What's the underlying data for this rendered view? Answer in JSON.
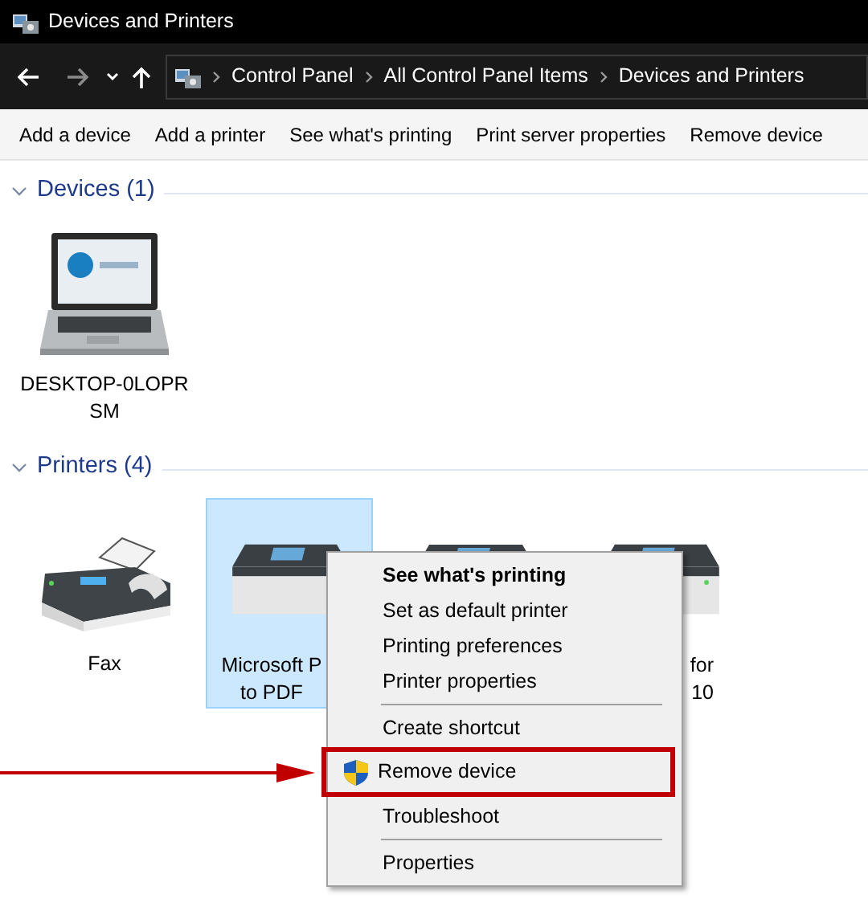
{
  "window": {
    "title": "Devices and Printers"
  },
  "address_bar": {
    "breadcrumbs": [
      "Control Panel",
      "All Control Panel Items",
      "Devices and Printers"
    ]
  },
  "command_bar": [
    "Add a device",
    "Add a printer",
    "See what's printing",
    "Print server properties",
    "Remove device"
  ],
  "sections": [
    {
      "title": "Devices (1)",
      "expanded": true,
      "items": [
        {
          "kind": "laptop",
          "label_lines": [
            "DESKTOP-0LOPR",
            "SM"
          ],
          "selected": false
        }
      ]
    },
    {
      "title": "Printers (4)",
      "expanded": true,
      "items": [
        {
          "kind": "fax",
          "label_lines": [
            "Fax"
          ],
          "selected": false
        },
        {
          "kind": "printer",
          "label_lines": [
            "Microsoft P",
            "to PDF"
          ],
          "selected": true
        },
        {
          "kind": "printer",
          "selected": false
        },
        {
          "kind": "printer",
          "label_lines": [
            "for",
            "10"
          ],
          "selected": false
        }
      ]
    }
  ],
  "context_menu": [
    {
      "kind": "item",
      "label": "See what's printing",
      "default": true,
      "highlighted": false
    },
    {
      "kind": "item",
      "label": "Set as default printer",
      "default": false,
      "highlighted": false
    },
    {
      "kind": "item",
      "label": "Printing preferences",
      "default": false,
      "highlighted": false
    },
    {
      "kind": "item",
      "label": "Printer properties",
      "default": false,
      "highlighted": false
    },
    {
      "kind": "separator"
    },
    {
      "kind": "item",
      "label": "Create shortcut",
      "default": false,
      "highlighted": false
    },
    {
      "kind": "shield_item",
      "label": "Remove device",
      "default": false,
      "highlighted": true
    },
    {
      "kind": "item",
      "label": "Troubleshoot",
      "default": false,
      "highlighted": false
    },
    {
      "kind": "separator"
    },
    {
      "kind": "item",
      "label": "Properties",
      "default": false,
      "highlighted": false
    }
  ]
}
